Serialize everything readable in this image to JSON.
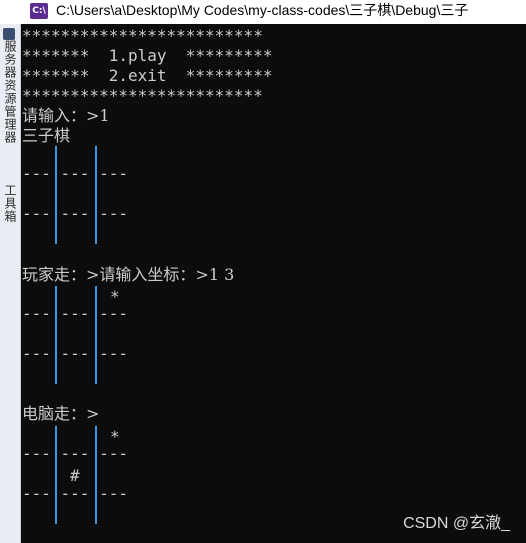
{
  "window": {
    "app_icon": "C:\\",
    "title": "C:\\Users\\a\\Desktop\\My Codes\\my-class-codes\\三子棋\\Debug\\三子"
  },
  "sidebar": {
    "panel1": "服务器资源管理器",
    "panel2": "工具箱"
  },
  "console": {
    "menu_border_top": "*************************",
    "menu_play": "*******  1.play  *********",
    "menu_exit": "*******  2.exit  *********",
    "menu_border_bottom": "*************************",
    "prompt_input": "请输入：>1",
    "game_name": "三子棋",
    "board_row_sep": "--- --- ---",
    "player_prompt": "玩家走：>请输入坐标：>1 3",
    "player_mark": "*",
    "computer_prompt": "电脑走：>",
    "computer_mark": "#"
  },
  "watermark": "CSDN @玄澈_",
  "colors": {
    "console_bg": "#0c0c0c",
    "console_text": "#cccccc",
    "grid_line": "#3a96dd"
  }
}
